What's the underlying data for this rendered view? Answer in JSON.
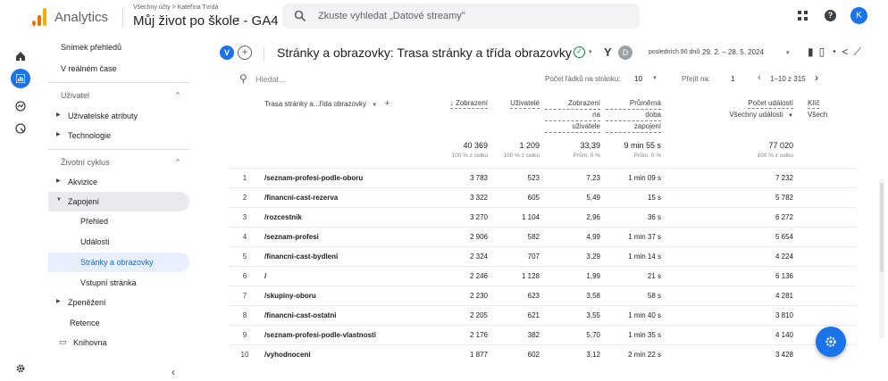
{
  "topbar": {
    "app_name": "Analytics",
    "breadcrumb": "Všechny účty > Kateřina Tvrdá",
    "property": "Můj život po škole - GA4",
    "search_placeholder": "Zkuste vyhledat „Datové streamy\"",
    "avatar_letter": "K"
  },
  "nav": {
    "snimek": "Snímek přehledů",
    "realtime": "V reálném čase",
    "section_user": "Uživatel",
    "user_attrs": "Uživatelské atributy",
    "tech": "Technologie",
    "section_lifecycle": "Životní cyklus",
    "akvizice": "Akvizice",
    "zapojeni": "Zapojení",
    "prehled": "Přehled",
    "udalosti": "Události",
    "stranky": "Stránky a obrazovky",
    "vstupni": "Vstupní stránka",
    "zpenezeni": "Zpeněžení",
    "retence": "Retence",
    "knihovna": "Knihovna"
  },
  "header": {
    "comparison_badge": "V",
    "title": "Stránky a obrazovky: Trasa stránky a třída obrazovky",
    "filter_badge": "D",
    "date_label": "posledních 90 dnů",
    "date_range": "29. 2. – 28. 5. 2024"
  },
  "table_controls": {
    "search_placeholder": "Hledat...",
    "rows_label": "Počet řádků na stránku:",
    "rows_value": "10",
    "goto_label": "Přejít na:",
    "goto_value": "1",
    "pager_text": "1–10 z 315"
  },
  "table": {
    "dim_header": "Trasa stránky a...řída obrazovky",
    "col_views": "↓ Zobrazení",
    "col_users": "Uživatelé",
    "col_vpu_1": "Zobrazení",
    "col_vpu_2": "na",
    "col_vpu_3": "uživatele",
    "col_avg_1": "Průměrná",
    "col_avg_2": "doba",
    "col_avg_3": "zapojení",
    "col_events": "Počet událostí",
    "col_events_sub": "Všechny události",
    "col_key": "Klíč",
    "col_key_sub": "Všech",
    "totals": {
      "views": "40 369",
      "views_sub": "100 % z celku",
      "users": "1 209",
      "users_sub": "100 % z celku",
      "vpu": "33,39",
      "vpu_sub": "Prům. 0 %",
      "avg": "9 min 55 s",
      "avg_sub": "Prům. 0 %",
      "events": "77 020",
      "events_sub": "100 % z celku"
    },
    "rows": [
      {
        "i": "1",
        "path": "/seznam-profesi-podle-oboru",
        "views": "3 783",
        "users": "523",
        "vpu": "7,23",
        "avg": "1 min 09 s",
        "events": "7 232"
      },
      {
        "i": "2",
        "path": "/financni-cast-rezerva",
        "views": "3 322",
        "users": "605",
        "vpu": "5,49",
        "avg": "15 s",
        "events": "5 782"
      },
      {
        "i": "3",
        "path": "/rozcestnik",
        "views": "3 270",
        "users": "1 104",
        "vpu": "2,96",
        "avg": "36 s",
        "events": "6 272"
      },
      {
        "i": "4",
        "path": "/seznam-profesi",
        "views": "2 906",
        "users": "582",
        "vpu": "4,99",
        "avg": "1 min 37 s",
        "events": "5 654"
      },
      {
        "i": "5",
        "path": "/financni-cast-bydleni",
        "views": "2 324",
        "users": "707",
        "vpu": "3,29",
        "avg": "1 min 14 s",
        "events": "4 224"
      },
      {
        "i": "6",
        "path": "/",
        "views": "2 246",
        "users": "1 128",
        "vpu": "1,99",
        "avg": "21 s",
        "events": "6 136"
      },
      {
        "i": "7",
        "path": "/skupiny-oboru",
        "views": "2 230",
        "users": "623",
        "vpu": "3,58",
        "avg": "58 s",
        "events": "4 281"
      },
      {
        "i": "8",
        "path": "/financni-cast-ostatni",
        "views": "2 205",
        "users": "621",
        "vpu": "3,55",
        "avg": "1 min 40 s",
        "events": "3 810"
      },
      {
        "i": "9",
        "path": "/seznam-profesi-podle-vlastnosti",
        "views": "2 176",
        "users": "382",
        "vpu": "5,70",
        "avg": "1 min 35 s",
        "events": "4 140"
      },
      {
        "i": "10",
        "path": "/vyhodnoceni",
        "views": "1 877",
        "users": "602",
        "vpu": "3,12",
        "avg": "2 min 22 s",
        "events": "3 428"
      }
    ]
  },
  "colors": {
    "accent": "#1a73e8",
    "nav_selected_bg": "#e8f0fe",
    "nav_hover_bg": "#e8eaed"
  }
}
